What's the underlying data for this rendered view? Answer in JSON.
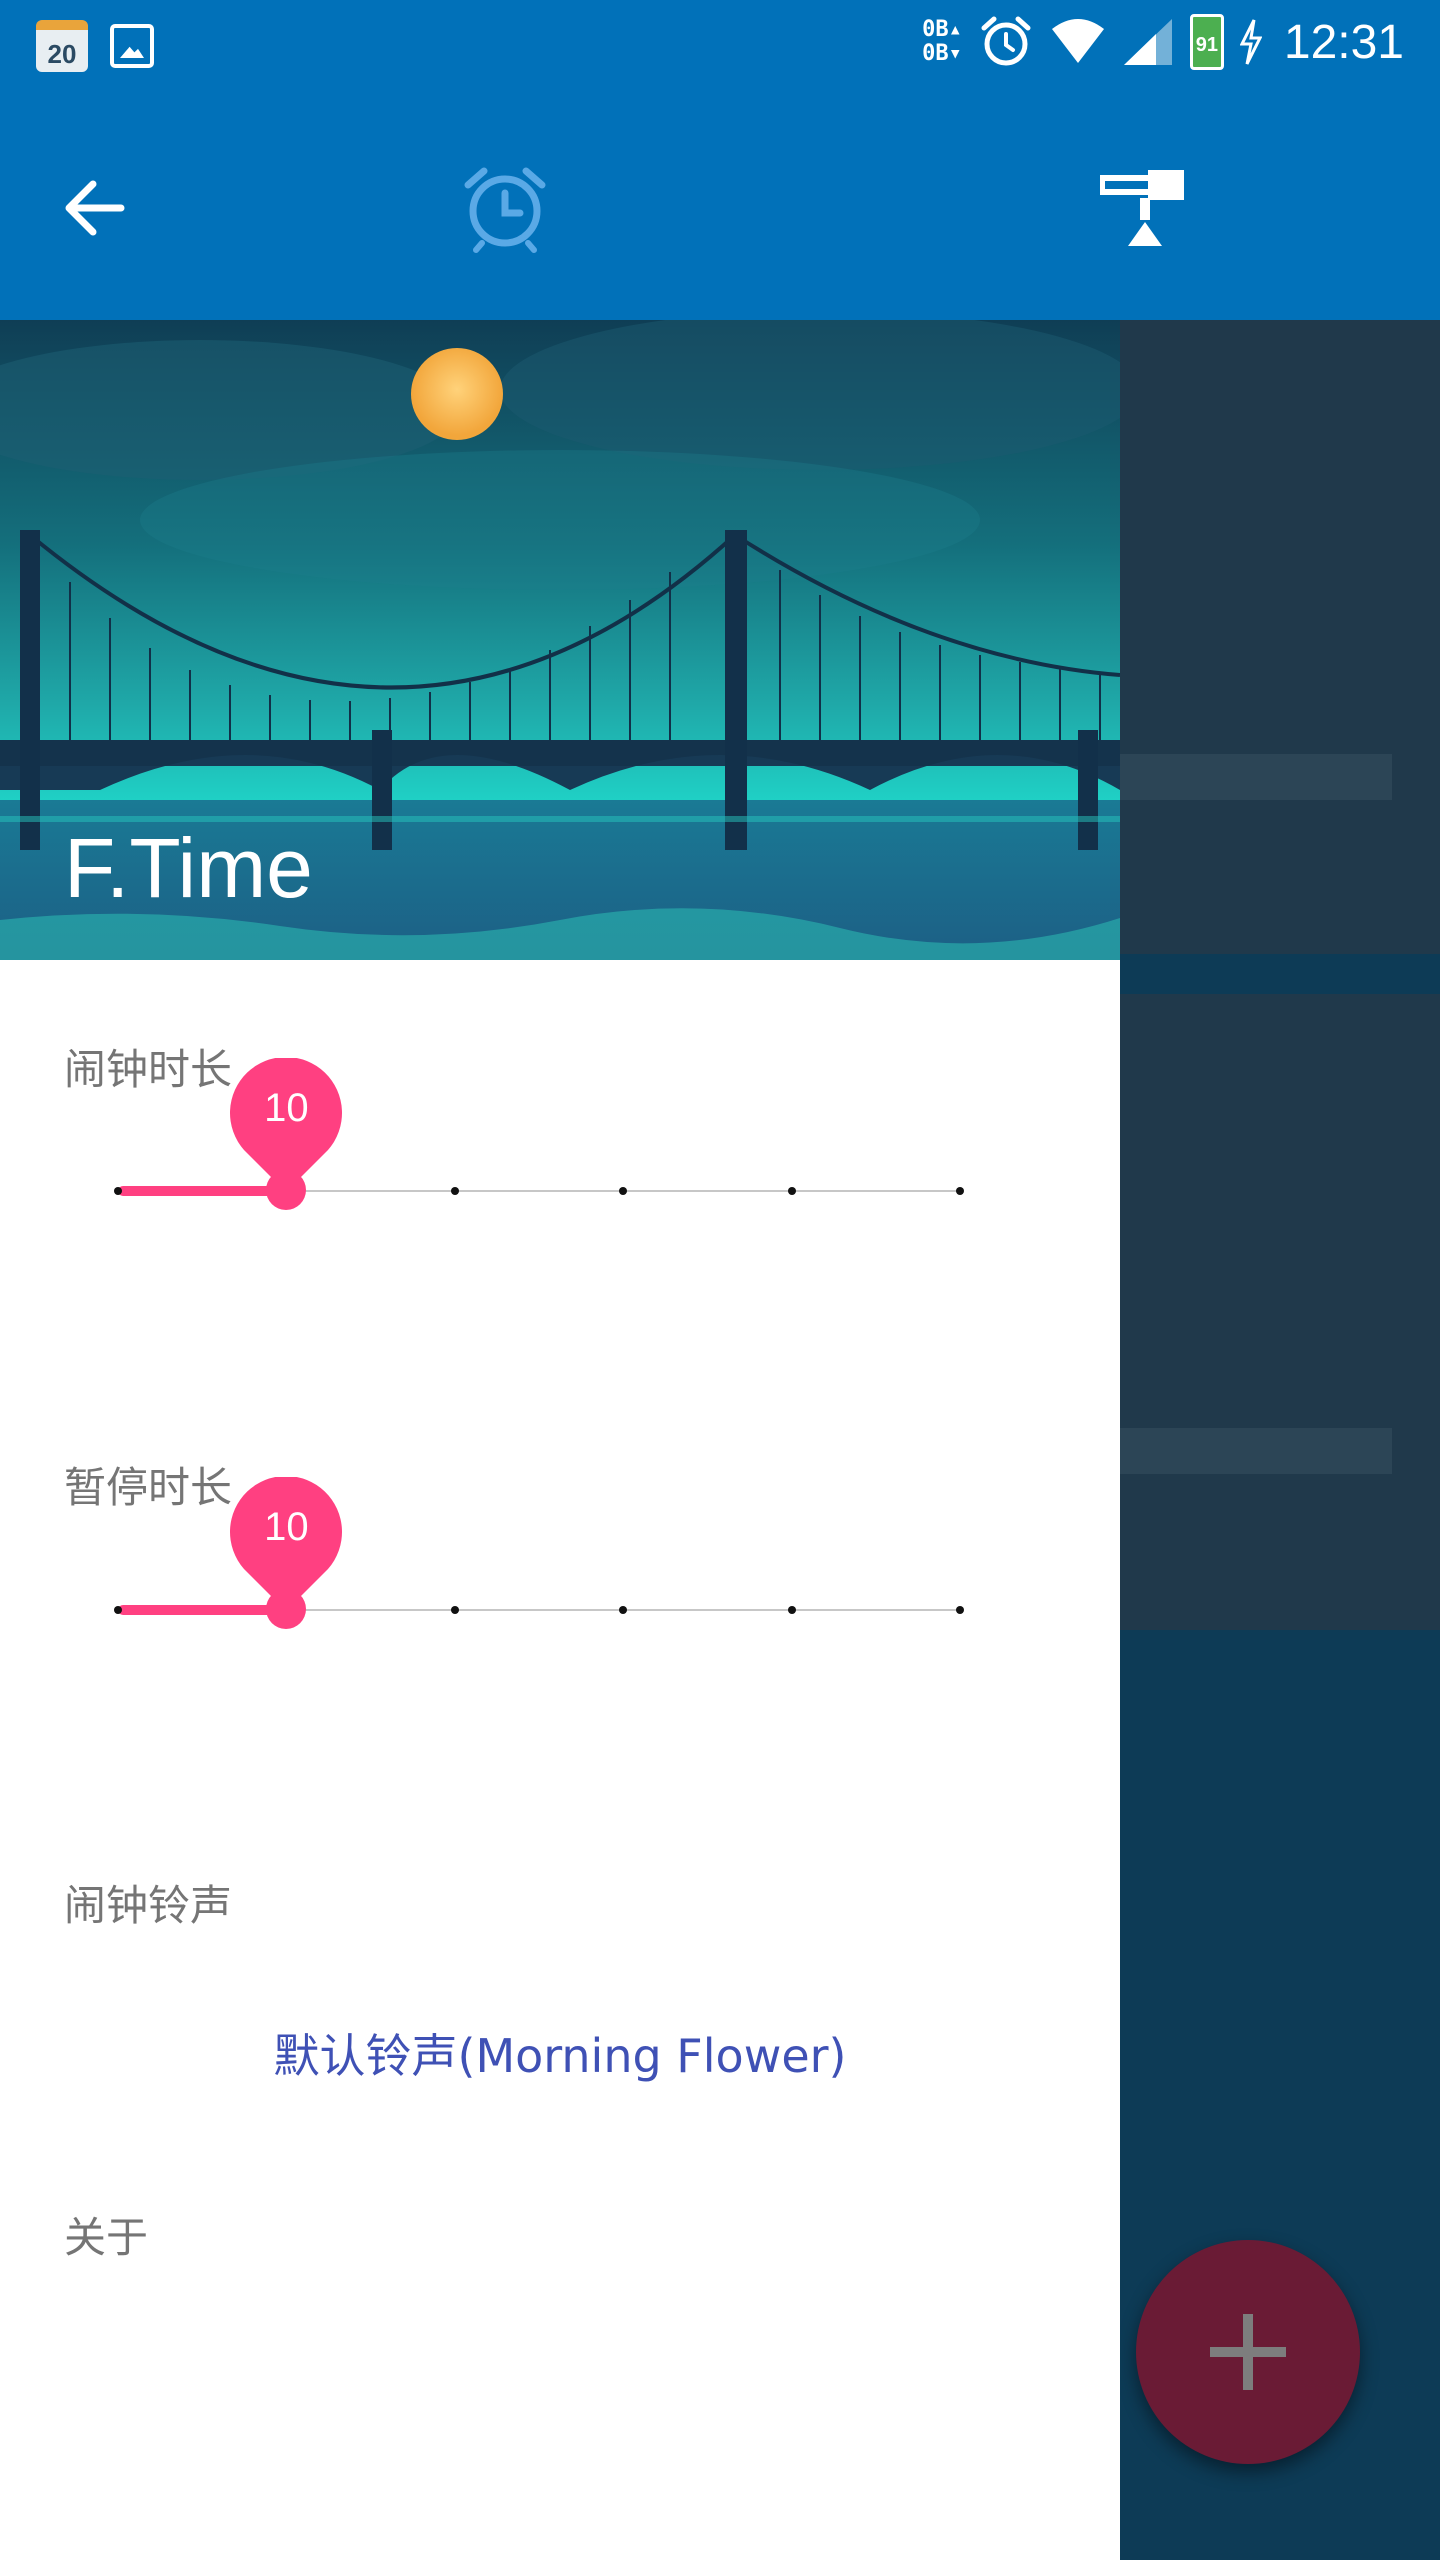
{
  "status_bar": {
    "calendar_day": "20",
    "data_up": "0B",
    "data_down": "0B",
    "battery_level": "91",
    "time": "12:31",
    "icons": [
      "calendar-icon",
      "gallery-icon",
      "data-transfer-icon",
      "alarm-icon",
      "wifi-icon",
      "signal-icon",
      "battery-charging-icon"
    ]
  },
  "app_bar": {
    "icons": [
      "back-arrow-icon",
      "alarm-clock-icon",
      "settings-icon"
    ]
  },
  "drawer": {
    "title": "F.Time",
    "alarm_duration": {
      "label": "闹钟时长",
      "value": "10",
      "value_fraction": 0.2,
      "ticks": 6
    },
    "snooze_duration": {
      "label": "暂停时长",
      "value": "10",
      "value_fraction": 0.2,
      "ticks": 6
    },
    "alarm_ringtone": {
      "label": "闹钟铃声",
      "value": "默认铃声(Morning Flower)"
    },
    "about": {
      "label": "关于"
    }
  },
  "fab": {
    "icon": "plus-icon"
  },
  "colors": {
    "primary": "#0171b9",
    "accent": "#ff4081",
    "ringtone_text": "#3f51b5",
    "label_text": "#757575"
  }
}
